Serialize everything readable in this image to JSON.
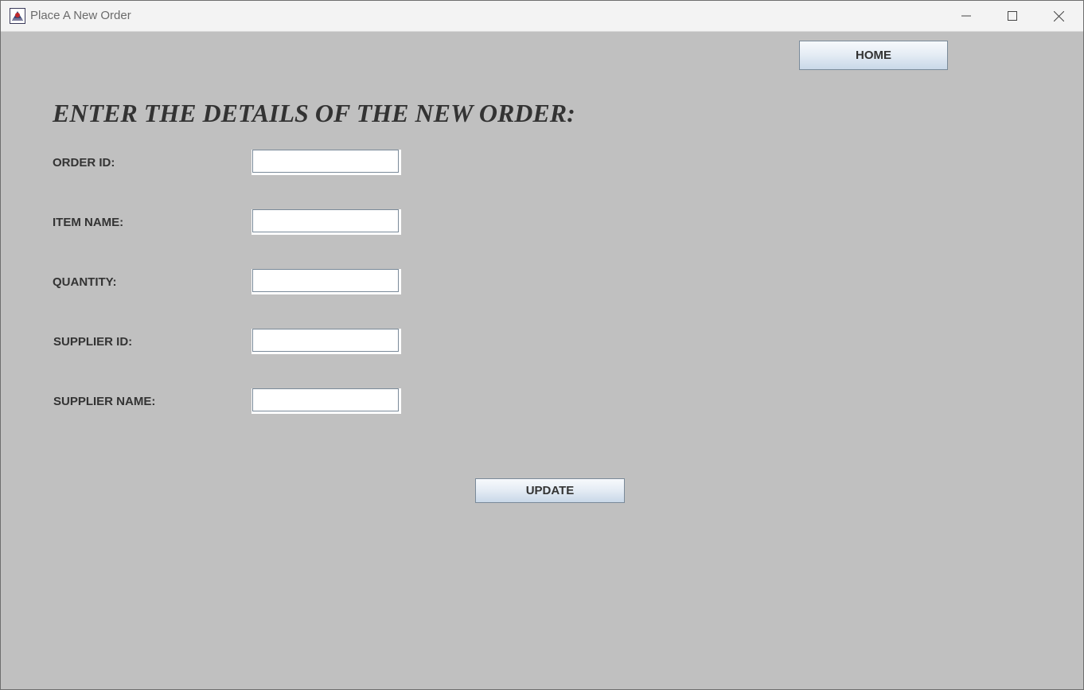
{
  "window": {
    "title": "Place A New Order",
    "minimize_label": "─",
    "maximize_label": "☐",
    "close_label": "✕"
  },
  "toolbar": {
    "home_label": "HOME"
  },
  "form": {
    "heading": "ENTER THE DETAILS OF THE NEW ORDER:",
    "fields": [
      {
        "label": "ORDER ID:",
        "value": ""
      },
      {
        "label": "ITEM NAME:",
        "value": ""
      },
      {
        "label": "QUANTITY:",
        "value": ""
      },
      {
        "label": "SUPPLIER ID:",
        "value": ""
      },
      {
        "label": "SUPPLIER NAME:",
        "value": ""
      }
    ],
    "update_label": "UPDATE"
  },
  "colors": {
    "background": "#c0c0c0",
    "titlebar": "#f3f3f3",
    "text": "#333333",
    "button_border": "#7a8a99"
  },
  "icons": {
    "app": "java-app-icon",
    "minimize": "minimize-icon",
    "maximize": "maximize-icon",
    "close": "close-icon"
  }
}
